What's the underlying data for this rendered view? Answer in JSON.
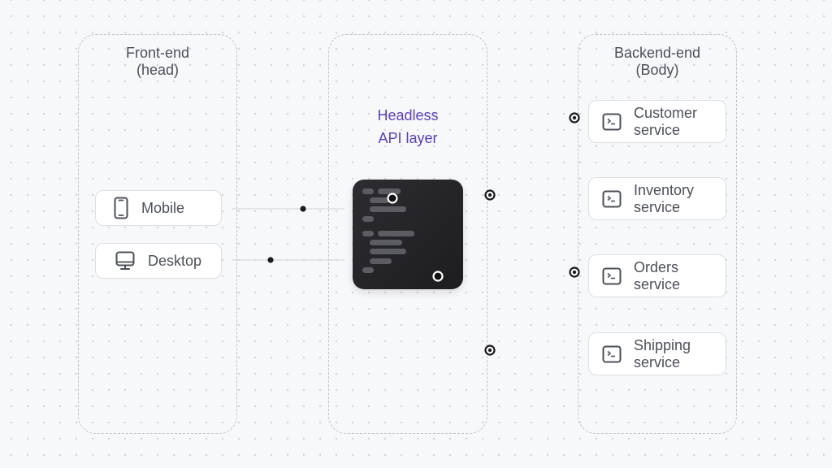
{
  "diagram": {
    "frontend": {
      "title": "Front-end\n(head)",
      "clients": [
        {
          "label": "Mobile",
          "icon": "mobile-phone-icon"
        },
        {
          "label": "Desktop",
          "icon": "desktop-monitor-icon"
        }
      ]
    },
    "api": {
      "title": "Headless\nAPI layer",
      "icon": "code-editor-icon"
    },
    "backend": {
      "title": "Backend-end\n(Body)",
      "services": [
        {
          "label": "Customer\nservice",
          "icon": "terminal-icon"
        },
        {
          "label": "Inventory\nservice",
          "icon": "terminal-icon"
        },
        {
          "label": "Orders\nservice",
          "icon": "terminal-icon"
        },
        {
          "label": "Shipping\nservice",
          "icon": "terminal-icon"
        }
      ]
    },
    "colors": {
      "accent": "#5a3fc2",
      "text": "#4b5058",
      "code_bg": "#252528"
    }
  }
}
